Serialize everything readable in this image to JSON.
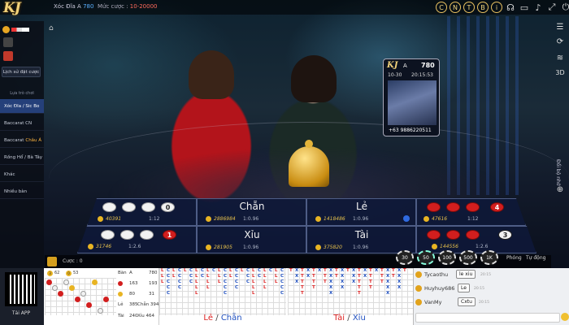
{
  "header": {
    "logo_text": "KJ",
    "game_name": "Xóc Đĩa A",
    "game_number": "780",
    "bet_label": "Mức cược :",
    "bet_range": "10-20000",
    "icons": [
      {
        "name": "c-icon",
        "glyph": "C"
      },
      {
        "name": "n-icon",
        "glyph": "N"
      },
      {
        "name": "t-icon",
        "glyph": "T"
      },
      {
        "name": "b-icon",
        "glyph": "B"
      },
      {
        "name": "info-icon",
        "glyph": "i"
      },
      {
        "name": "headset-icon",
        "glyph": "☊"
      },
      {
        "name": "tv-icon",
        "glyph": "▭"
      },
      {
        "name": "sound-icon",
        "glyph": "♪"
      },
      {
        "name": "fullscreen-icon",
        "glyph": "⤢"
      },
      {
        "name": "exit-icon",
        "glyph": "⏻"
      }
    ]
  },
  "sidebar": {
    "history_button": "Lịch sử đặt cược",
    "section_title": "Lựa trò chơi",
    "items": [
      {
        "label": "Xóc Đĩa / Sic Bo",
        "accent": "",
        "active": true
      },
      {
        "label": "Baccarat CN",
        "accent": "",
        "active": false
      },
      {
        "label": "Baccarat",
        "accent": "Châu Á",
        "active": false
      },
      {
        "label": "Rồng Hổ / Bà Tây",
        "accent": "",
        "active": false
      },
      {
        "label": "Khác",
        "accent": "",
        "active": false
      },
      {
        "label": "Nhiều bàn",
        "accent": "",
        "active": false
      }
    ],
    "qr_label": "Tải APP"
  },
  "right_bar": {
    "vertical_label": "Đổi bộ nhớ",
    "hd_label": "3D"
  },
  "stream_card": {
    "logo": "KJ",
    "name": "A",
    "number": "780",
    "date": "10-30",
    "time": "20:15:53",
    "phone": "+63 9886220511"
  },
  "board": {
    "chan": {
      "label": "Chẵn",
      "amount": "2886984",
      "odds": "1:0.96"
    },
    "le": {
      "label": "Lẻ",
      "amount": "1418486",
      "odds": "1:0.96"
    },
    "xiu": {
      "label": "Xỉu",
      "amount": "281905",
      "odds": "1:0.96"
    },
    "tai": {
      "label": "Tài",
      "amount": "375820",
      "odds": "1:0.96"
    },
    "four_white": {
      "number": "0",
      "amount": "40391",
      "odds": "1:12"
    },
    "three_white": {
      "number": "1",
      "amount": "31746",
      "odds": "1:2.6"
    },
    "four_red": {
      "number": "4",
      "amount": "47616",
      "odds": "1:12"
    },
    "three_red": {
      "number": "3",
      "amount": "144556",
      "odds": "1:2.6"
    }
  },
  "controls": {
    "bet_label": "Cược : 0",
    "chips": [
      "30",
      "50",
      "100",
      "500",
      "1K"
    ],
    "repeat_label": "Phóng",
    "auto_label": "Tự động"
  },
  "roads": {
    "left_counts": [
      {
        "label": "3",
        "value": "62"
      },
      {
        "label": "0",
        "value": "53"
      }
    ],
    "stats": {
      "col1": "Bàn",
      "col2": "Văn",
      "rows": [
        {
          "label": "Bàn",
          "v1": "A",
          "v2": "780"
        },
        {
          "label": "",
          "v1": "163",
          "v2": "193"
        },
        {
          "label": "",
          "v1": "80",
          "v2": "31"
        },
        {
          "label": "Lẻ",
          "v1": "385",
          "v2": "Chẵn 394"
        },
        {
          "label": "Tài",
          "v1": "240",
          "v2": "Xỉu 464"
        }
      ]
    },
    "label_lc": {
      "a": "Lẻ",
      "b": "Chẵn"
    },
    "label_tx": {
      "a": "Tài",
      "b": "Xỉu"
    }
  },
  "chat": {
    "messages": [
      {
        "name": "Tycaothu",
        "text": "le xiu",
        "time": "20:15"
      },
      {
        "name": "Huyhuy686",
        "text": "Le",
        "time": "20:15"
      },
      {
        "name": "VanMy",
        "text": "Cxtu",
        "time": "20:15"
      }
    ]
  },
  "colors": {
    "accent_gold": "#f2d27a",
    "red_chip": "#d21e1e",
    "board_blue": "#0e1838",
    "active_blue": "#25407a"
  }
}
